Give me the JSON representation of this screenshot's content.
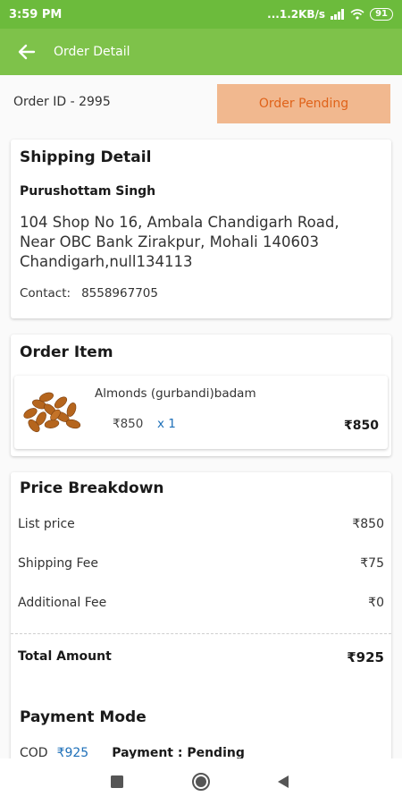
{
  "status_bar": {
    "time": "3:59 PM",
    "network": "...1.2KB/s",
    "battery": "91"
  },
  "app_bar": {
    "title": "Order Detail",
    "back_icon": "arrow-left-icon"
  },
  "order": {
    "id_label": "Order ID - 2995",
    "status": "Order Pending"
  },
  "shipping": {
    "title": "Shipping Detail",
    "name": "Purushottam Singh",
    "address_lines": [
      "104 Shop No 16, Ambala Chandigarh Road,",
      "Near OBC Bank Zirakpur, Mohali 140603",
      "Chandigarh,null134113"
    ],
    "contact_label": "Contact:",
    "contact_value": "8558967705"
  },
  "order_item": {
    "title": "Order Item",
    "name": "Almonds (gurbandi)badam",
    "price": "₹850",
    "quantity": "x 1",
    "total": "₹850",
    "image_icon": "almonds-image"
  },
  "price_breakdown": {
    "title": "Price Breakdown",
    "rows": [
      {
        "label": "List price",
        "value": "₹850"
      },
      {
        "label": "Shipping Fee",
        "value": "₹75"
      },
      {
        "label": "Additional Fee",
        "value": "₹0"
      }
    ],
    "total_label": "Total Amount",
    "total_value": "₹925"
  },
  "payment": {
    "title": "Payment Mode",
    "method": "COD",
    "amount": "₹925",
    "status": "Payment : Pending"
  },
  "nav": {
    "icons": [
      "square-icon",
      "circle-icon",
      "triangle-back-icon"
    ]
  },
  "colors": {
    "status_bar": "#6cbb3c",
    "app_bar": "#7ec24a",
    "pending_bg": "#f1b88f",
    "pending_text": "#e0631a",
    "link_blue": "#1d6fb8"
  }
}
